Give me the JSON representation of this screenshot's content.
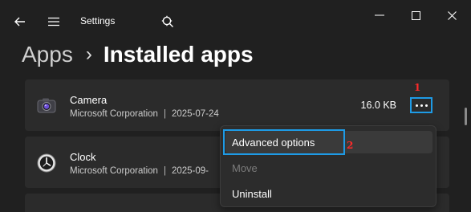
{
  "window": {
    "title": "Settings"
  },
  "breadcrumb": {
    "parent": "Apps",
    "separator": "›",
    "current": "Installed apps"
  },
  "apps": [
    {
      "name": "Camera",
      "publisher": "Microsoft Corporation",
      "separator": "|",
      "date": "2025-07-24",
      "size": "16.0 KB",
      "icon": "camera-icon"
    },
    {
      "name": "Clock",
      "publisher": "Microsoft Corporation",
      "separator": "|",
      "date": "2025-09-",
      "icon": "clock-icon"
    }
  ],
  "context_menu": {
    "items": [
      {
        "label": "Advanced options",
        "enabled": true,
        "highlighted": true
      },
      {
        "label": "Move",
        "enabled": false
      },
      {
        "label": "Uninstall",
        "enabled": true
      }
    ]
  },
  "annotations": {
    "step1": "1",
    "step2": "2",
    "color": "#ff2a2a",
    "highlight_color": "#1e9be6"
  },
  "colors": {
    "background": "#202020",
    "card": "#2b2b2b",
    "menu": "#2c2c2c",
    "disabled_text": "#7b7b7b"
  }
}
